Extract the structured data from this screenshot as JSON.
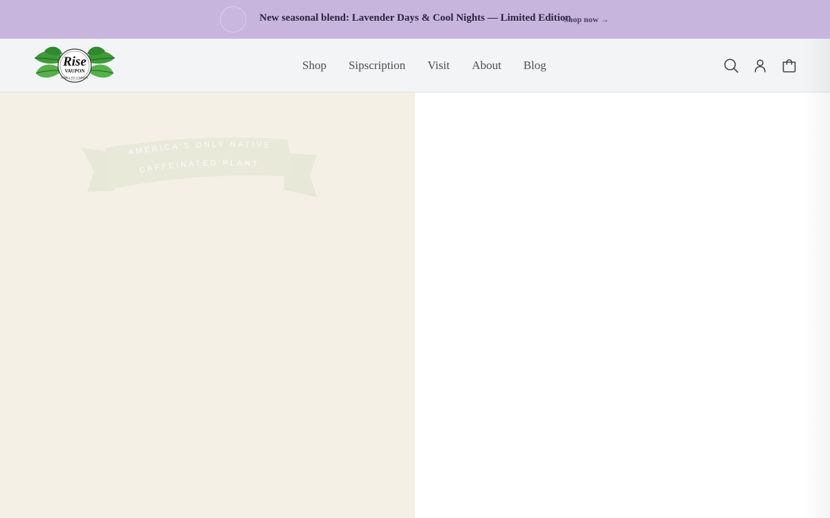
{
  "announcement": {
    "text": "New seasonal blend: Lavender Days & Cool Nights — Limited Edition",
    "link_label": "Shop now →"
  },
  "header": {
    "logo": {
      "brand": "Rise",
      "sub": "VAUPON",
      "tagline": "FAMILY TEA COMPANY"
    },
    "nav": [
      {
        "label": "Shop"
      },
      {
        "label": "Sipscription"
      },
      {
        "label": "Visit"
      },
      {
        "label": "About"
      },
      {
        "label": "Blog"
      }
    ],
    "icons": [
      "search-icon",
      "account-icon",
      "cart-icon"
    ]
  },
  "hero": {
    "ribbon_line1": "AMERICA'S ONLY NATIVE",
    "ribbon_line2": "CAFFEINATED PLANT"
  },
  "colors": {
    "announcement_bg": "#c8b5de",
    "header_bg": "#f2f4f6",
    "hero_left_bg": "#f5f0e6",
    "ribbon": "#e6e6d6"
  }
}
